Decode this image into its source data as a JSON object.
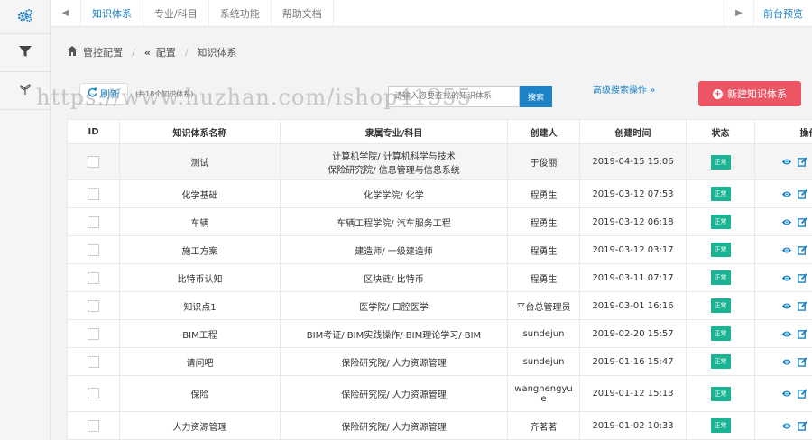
{
  "topbar": {
    "tabs": [
      "知识体系",
      "专业/科目",
      "系统功能",
      "帮助文档"
    ],
    "front_link": "前台预览"
  },
  "breadcrumb": {
    "home": "管控配置",
    "config": "配置",
    "current": "知识体系"
  },
  "toolbar": {
    "refresh_label": "刷新",
    "count_text": "(共18个知识体系)",
    "search_placeholder": "请输入您要查找的知识体系",
    "search_label": "搜索",
    "advanced_label": "高级搜索操作",
    "new_label": "新建知识体系"
  },
  "watermark": "https://www.huzhan.com/ishop41355",
  "table": {
    "headers": [
      "ID",
      "知识体系名称",
      "隶属专业/科目",
      "创建人",
      "创建时间",
      "状态",
      "操作"
    ],
    "rows": [
      {
        "name": "测试",
        "major": "计算机学院/ 计算机科学与技术",
        "major2": "保险研究院/ 信息管理与信息系统",
        "creator": "于俊丽",
        "creator2": "",
        "time": "2019-04-15 15:06",
        "status": "正常"
      },
      {
        "name": "化学基础",
        "major": "化学学院/ 化学",
        "major2": "",
        "creator": "程勇生",
        "creator2": "",
        "time": "2019-03-12 07:53",
        "status": "正常"
      },
      {
        "name": "车辆",
        "major": "车辆工程学院/ 汽车服务工程",
        "major2": "",
        "creator": "程勇生",
        "creator2": "",
        "time": "2019-03-12 06:18",
        "status": "正常"
      },
      {
        "name": "施工方案",
        "major": "建造师/ 一级建造师",
        "major2": "",
        "creator": "程勇生",
        "creator2": "",
        "time": "2019-03-12 03:17",
        "status": "正常"
      },
      {
        "name": "比特币认知",
        "major": "区块链/ 比特币",
        "major2": "",
        "creator": "程勇生",
        "creator2": "",
        "time": "2019-03-11 07:17",
        "status": "正常"
      },
      {
        "name": "知识点1",
        "major": "医学院/ 口腔医学",
        "major2": "",
        "creator": "平台总管理员",
        "creator2": "",
        "time": "2019-03-01 16:16",
        "status": "正常"
      },
      {
        "name": "BIM工程",
        "major": "BIM考证/ BIM实践操作/ BIM理论学习/ BIM",
        "major2": "",
        "creator": "sundejun",
        "creator2": "",
        "time": "2019-02-20 15:57",
        "status": "正常"
      },
      {
        "name": "请问吧",
        "major": "保险研究院/ 人力资源管理",
        "major2": "",
        "creator": "sundejun",
        "creator2": "",
        "time": "2019-01-16 15:47",
        "status": "正常"
      },
      {
        "name": "保险",
        "major": "保险研究院/ 人力资源管理",
        "major2": "",
        "creator": "wanghengyu",
        "creator2": "e",
        "time": "2019-01-12 15:13",
        "status": "正常"
      },
      {
        "name": "人力资源管理",
        "major": "保险研究院/ 人力资源管理",
        "major2": "",
        "creator": "齐茗茗",
        "creator2": "",
        "time": "2019-01-02 10:33",
        "status": "正常"
      }
    ]
  },
  "colors": {
    "accent": "#1c84c6",
    "danger": "#ed5565",
    "success": "#1ab394"
  }
}
